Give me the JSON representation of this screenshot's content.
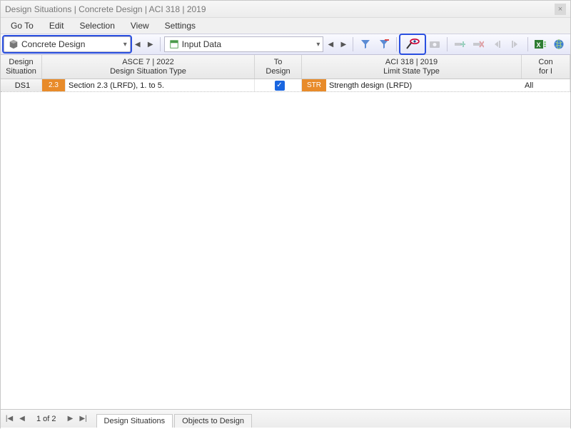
{
  "window": {
    "title": "Design Situations | Concrete Design | ACI 318 | 2019"
  },
  "menu": {
    "goto": "Go To",
    "edit": "Edit",
    "selection": "Selection",
    "view": "View",
    "settings": "Settings"
  },
  "toolbar": {
    "combo_main": "Concrete Design",
    "combo_input": "Input Data"
  },
  "grid": {
    "headers": {
      "ds": "Design\nSituation",
      "type_top": "ASCE 7 | 2022",
      "type_bottom": "Design Situation Type",
      "to": "To\nDesign",
      "limit_top": "ACI 318 | 2019",
      "limit_bottom": "Limit State Type",
      "con": "Con\nfor I"
    },
    "row": {
      "ds": "DS1",
      "badge1": "2.3",
      "type": "Section 2.3 (LRFD), 1. to 5.",
      "badge2": "STR",
      "limit": "Strength design (LRFD)",
      "con": "All"
    }
  },
  "status": {
    "page": "1 of 2",
    "tab1": "Design Situations",
    "tab2": "Objects to Design"
  }
}
